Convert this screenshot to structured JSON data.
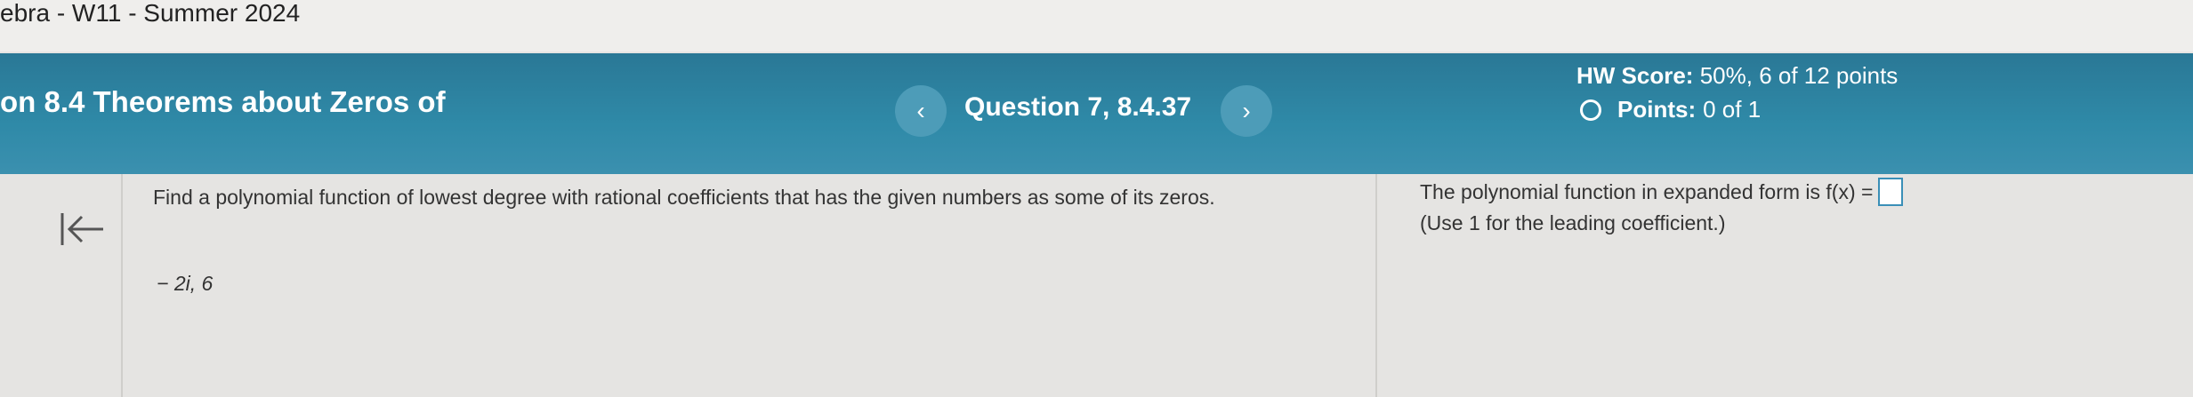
{
  "course": {
    "title": "ebra - W11 - Summer 2024"
  },
  "header": {
    "section_title": "on 8.4 Theorems about Zeros of",
    "question_label": "Question 7, 8.4.37",
    "prev_symbol": "‹",
    "next_symbol": "›",
    "hw_score_label": "HW Score:",
    "hw_score_value": "50%, 6 of 12 points",
    "points_label": "Points:",
    "points_value": "0 of 1"
  },
  "problem": {
    "text": "Find a polynomial function of lowest degree with rational coefficients that has the given numbers as some of its zeros.",
    "zeros": "− 2i, 6"
  },
  "answer": {
    "prompt": "The polynomial function in expanded form is f(x) =",
    "hint": "(Use 1 for the leading coefficient.)"
  }
}
